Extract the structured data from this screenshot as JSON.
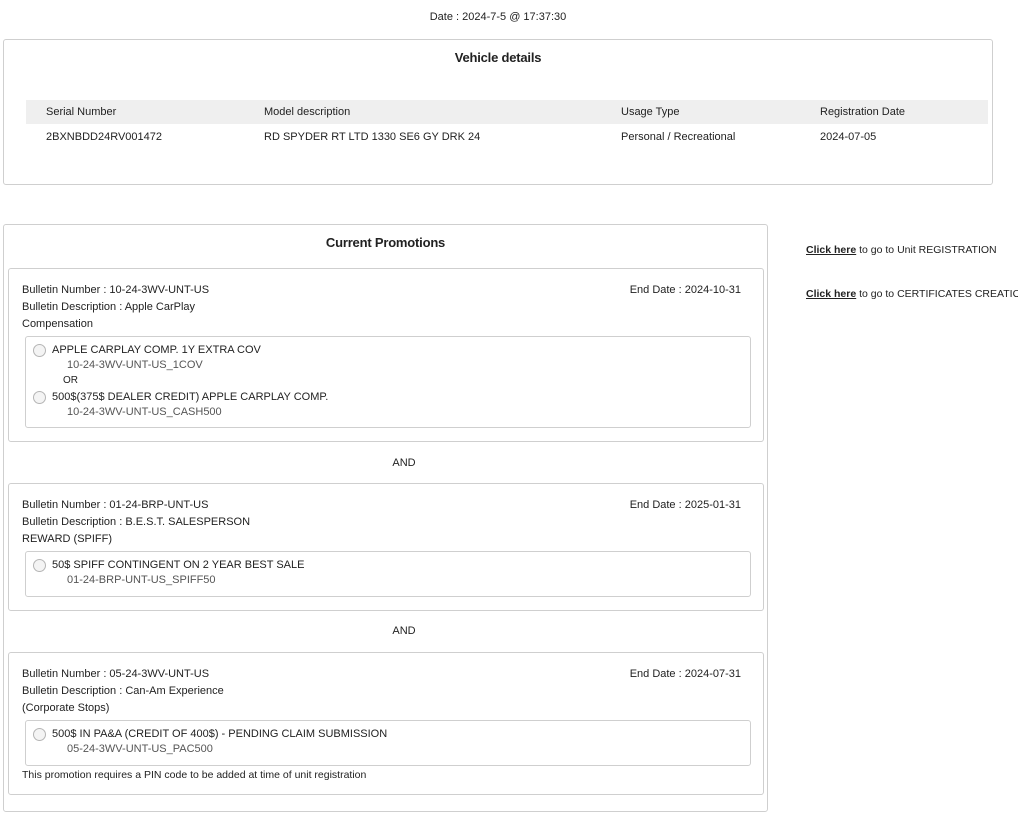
{
  "date_line": "Date : 2024-7-5 @ 17:37:30",
  "vehicle": {
    "title": "Vehicle details",
    "headers": [
      "Serial Number",
      "Model description",
      "Usage Type",
      "Registration Date"
    ],
    "row": [
      "2BXNBDD24RV001472",
      "RD SPYDER RT LTD 1330 SE6 GY DRK 24",
      "Personal / Recreational",
      "2024-07-05"
    ]
  },
  "promotions": {
    "title": "Current Promotions",
    "and_label": "AND",
    "or_label": "OR",
    "bulletins": [
      {
        "number": "Bulletin Number : 10-24-3WV-UNT-US",
        "description": "Bulletin Description : Apple CarPlay",
        "category": "Compensation",
        "end_date": "End Date : 2024-10-31",
        "options": [
          {
            "label": "APPLE CARPLAY COMP. 1Y EXTRA COV",
            "code": "10-24-3WV-UNT-US_1COV"
          },
          {
            "label": "500$(375$ DEALER CREDIT) APPLE CARPLAY COMP.",
            "code": "10-24-3WV-UNT-US_CASH500"
          }
        ]
      },
      {
        "number": "Bulletin Number : 01-24-BRP-UNT-US",
        "description": "Bulletin Description : B.E.S.T. SALESPERSON",
        "category": "REWARD (SPIFF)",
        "end_date": "End Date : 2025-01-31",
        "options": [
          {
            "label": "50$ SPIFF CONTINGENT ON 2 YEAR BEST SALE",
            "code": "01-24-BRP-UNT-US_SPIFF50"
          }
        ]
      },
      {
        "number": "Bulletin Number : 05-24-3WV-UNT-US",
        "description": "Bulletin Description : Can-Am Experience",
        "category": "(Corporate Stops)",
        "end_date": "End Date : 2024-07-31",
        "options": [
          {
            "label": "500$ IN PA&A (CREDIT OF 400$) - PENDING CLAIM SUBMISSION",
            "code": "05-24-3WV-UNT-US_PAC500"
          }
        ],
        "note": "This promotion requires a PIN code to be added at time of unit registration"
      }
    ]
  },
  "side_links": [
    {
      "link_text": "Click here",
      "rest": " to go to Unit REGISTRATION"
    },
    {
      "link_text": "Click here",
      "rest": " to go to CERTIFICATES CREATION"
    }
  ]
}
